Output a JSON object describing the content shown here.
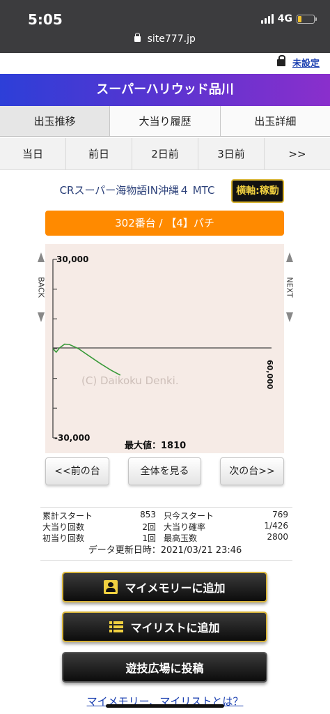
{
  "status": {
    "time": "5:05",
    "network": "4G",
    "url": "site777.jp"
  },
  "header": {
    "unset_link": "未設定",
    "title": "スーパーハリウッド品川"
  },
  "tabs_main": [
    "出玉推移",
    "大当り履歴",
    "出玉詳細"
  ],
  "tabs_day": [
    "当日",
    "前日",
    "2日前",
    "3日前",
    ">>"
  ],
  "machine": {
    "name": "CRスーパー海物語IN沖縄４ MTC",
    "axis_button": "横軸:稼動",
    "number_label": "302番台 / 【4】パチ"
  },
  "chart_data": {
    "type": "line",
    "ylim": [
      -30000,
      30000
    ],
    "xlim": [
      0,
      60000
    ],
    "y_ticks": [
      "30,000",
      "-30,000"
    ],
    "x_end_label": "60,000",
    "watermark": "(C) Daikoku Denki.",
    "max_label": "最大値：1810",
    "back_label": "BACK",
    "next_label": "NEXT",
    "series": [
      {
        "color": "#3a9a3a",
        "x": [
          0,
          900,
          1800,
          3200,
          4500,
          7000,
          10000,
          13000,
          16000,
          18500
        ],
        "y": [
          0,
          -1200,
          200,
          1500,
          1400,
          0,
          -2500,
          -5000,
          -7300,
          -8900
        ]
      }
    ]
  },
  "nav_buttons": {
    "prev": "<<前の台",
    "all": "全体を見る",
    "next": "次の台>>"
  },
  "stats": {
    "rows": [
      [
        "累計スタート",
        "853",
        "只今スタート",
        "769"
      ],
      [
        "大当り回数",
        "2回",
        "大当り確率",
        "1/426"
      ],
      [
        "初当り回数",
        "1回",
        "最高玉数",
        "2800"
      ]
    ],
    "updated": "データ更新日時：2021/03/21 23:46"
  },
  "actions": {
    "memory": "マイメモリーに追加",
    "list": "マイリストに追加",
    "post": "遊技広場に投稿"
  },
  "bottom_link": "マイメモリー、マイリストとは？",
  "colors": {
    "accent_orange": "#ff8a00",
    "gold": "#d8b43a",
    "line_green": "#3a9a3a"
  }
}
